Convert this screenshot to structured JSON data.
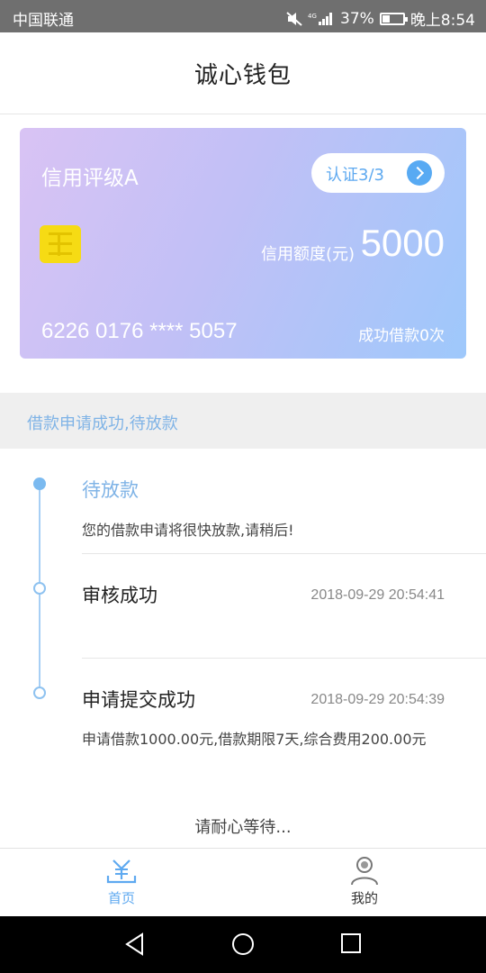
{
  "status_bar": {
    "carrier": "中国联通",
    "battery_pct": "37%",
    "time": "晚上8:54",
    "battery_level": 0.37
  },
  "header": {
    "title": "诚心钱包"
  },
  "card": {
    "rating": "信用评级A",
    "verify_label": "认证3/3",
    "limit_label": "信用额度(元)",
    "limit_value": "5000",
    "card_number": "6226 0176 **** 5057",
    "loan_count": "成功借款0次"
  },
  "status_band": {
    "text": "借款申请成功,待放款"
  },
  "timeline": [
    {
      "title": "待放款",
      "time": "",
      "desc": "您的借款申请将很快放款,请稍后!"
    },
    {
      "title": "审核成功",
      "time": "2018-09-29 20:54:41",
      "desc": ""
    },
    {
      "title": "申请提交成功",
      "time": "2018-09-29 20:54:39",
      "desc": "申请借款1000.00元,借款期限7天,综合费用200.00元"
    }
  ],
  "wait_text": "请耐心等待...",
  "tabs": {
    "home_label": "首页",
    "mine_label": "我的"
  },
  "colors": {
    "accent": "#5ea9f0",
    "card_start": "#d9c3f4",
    "card_end": "#9ec8fb",
    "band_bg": "#efefef"
  }
}
